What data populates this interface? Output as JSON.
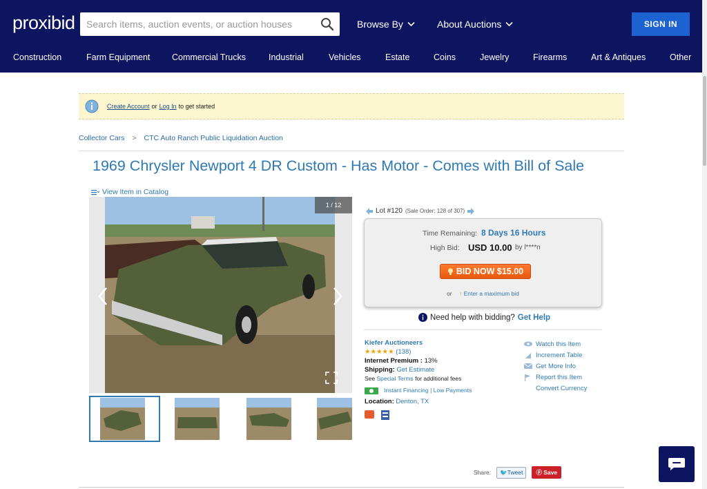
{
  "header": {
    "logo": "proxibid",
    "search_placeholder": "Search items, auction events, or auction houses",
    "browse_by": "Browse By",
    "about_auctions": "About Auctions",
    "sign_in": "SIGN IN"
  },
  "categories": [
    "Construction",
    "Farm Equipment",
    "Commercial Trucks",
    "Industrial",
    "Vehicles",
    "Estate",
    "Coins",
    "Jewelry",
    "Firearms",
    "Art & Antiques",
    "Other"
  ],
  "banner": {
    "create_account": "Create Account",
    "or": "or",
    "log_in": "Log In",
    "suffix": "to get started"
  },
  "breadcrumb": {
    "level1": "Collector Cars",
    "separator": ">",
    "level2": "CTC Auto Ranch Public Liquidation Auction"
  },
  "item": {
    "title": "1969 Chrysler Newport 4 DR Custom - Has Motor - Comes with Bill of Sale",
    "view_in_catalog": "View Item in Catalog",
    "photo_counter": "1 / 12"
  },
  "lot": {
    "label": "Lot #120",
    "sale_order": "(Sale Order: 128 of 307)"
  },
  "bidding": {
    "time_remaining_label": "Time Remaining:",
    "time_remaining_value": "8 Days 16 Hours",
    "high_bid_label": "High Bid:",
    "high_bid_value": "USD 10.00",
    "high_bid_by": "by l****n",
    "bid_now_button": "BID NOW $15.00",
    "or": "or",
    "max_bid_link": "Enter a maximum bid"
  },
  "help": {
    "text": "Need help with bidding?",
    "link": "Get Help"
  },
  "seller": {
    "name": "Kiefer Auctioneers",
    "stars": "★★★★★",
    "rating_count": "(138)",
    "premium_label": "Internet Premium :",
    "premium_value": "13%",
    "shipping_label": "Shipping:",
    "shipping_link": "Get Estimate",
    "see": "See",
    "special_terms": "Special Terms",
    "additional_fees": "for additional fees",
    "financing": "Instant Financing | Low Payments",
    "location_label": "Location:",
    "location_value": "Denton, TX"
  },
  "actions": {
    "watch": "Watch this Item",
    "increment": "Increment Table",
    "more_info": "Get More Info",
    "report": "Report this Item",
    "convert": "Convert Currency"
  },
  "share": {
    "label": "Share:",
    "tweet": "Tweet",
    "save": "Save"
  },
  "colors": {
    "header_bg": "#0d1460",
    "sign_in_bg": "#1c63d1",
    "link_blue": "#2f7ab3",
    "bid_orange": "#ff7a2e"
  }
}
